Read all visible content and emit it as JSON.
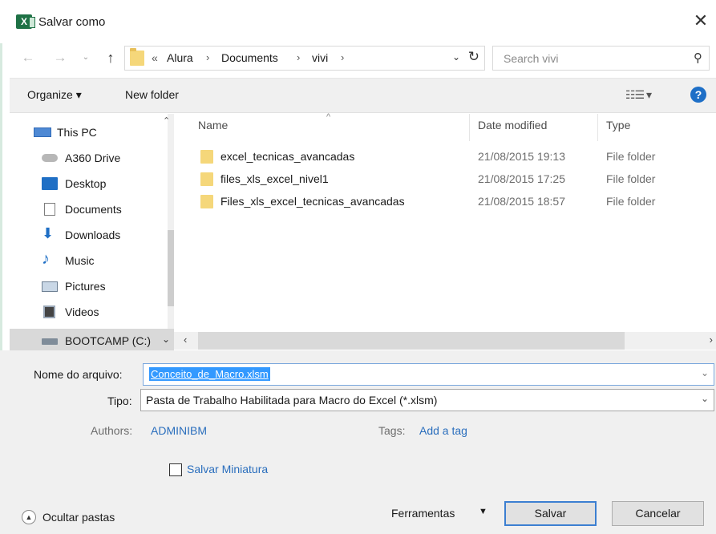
{
  "window": {
    "title": "Salvar como",
    "app_icon_letter": "X",
    "close_glyph": "✕",
    "accent_color": "#1e7145"
  },
  "navigation": {
    "back_glyph": "←",
    "forward_glyph": "→",
    "recent_glyph": "⌄",
    "up_glyph": "↑",
    "breadcrumb": [
      "«",
      "Alura",
      "Documents",
      "vivi"
    ],
    "separator_glyph": "›",
    "dropdown_glyph": "⌄",
    "refresh_glyph": "↻"
  },
  "search": {
    "placeholder": "Search vivi",
    "icon": "search-icon",
    "glyph": "⚲"
  },
  "toolbar": {
    "organize_label": "Organize ▾",
    "new_folder_label": "New folder",
    "view_label": "☷☰ ▾",
    "help_label": "?"
  },
  "sidebar": {
    "scroll_up_glyph": "⌃",
    "items": [
      {
        "label": "This PC",
        "icon": "computer-icon"
      },
      {
        "label": "A360 Drive",
        "icon": "cloud-icon"
      },
      {
        "label": "Desktop",
        "icon": "desktop-icon"
      },
      {
        "label": "Documents",
        "icon": "documents-icon"
      },
      {
        "label": "Downloads",
        "icon": "download-arrow-icon",
        "glyph": "⬇"
      },
      {
        "label": "Music",
        "icon": "music-note-icon",
        "glyph": "♪"
      },
      {
        "label": "Pictures",
        "icon": "pictures-icon"
      },
      {
        "label": "Videos",
        "icon": "film-icon"
      },
      {
        "label": "BOOTCAMP (C:)",
        "icon": "drive-icon",
        "expand_glyph": "⌄"
      }
    ]
  },
  "file_list": {
    "columns": {
      "name": "Name",
      "date": "Date modified",
      "type": "Type"
    },
    "sort_glyph": "^",
    "rows": [
      {
        "name": "excel_tecnicas_avancadas",
        "date": "21/08/2015 19:13",
        "type": "File folder"
      },
      {
        "name": "files_xls_excel_nivel1",
        "date": "21/08/2015 17:25",
        "type": "File folder"
      },
      {
        "name": "Files_xls_excel_tecnicas_avancadas",
        "date": "21/08/2015 18:57",
        "type": "File folder"
      }
    ],
    "scroll_left_glyph": "‹",
    "scroll_right_glyph": "›"
  },
  "save_form": {
    "filename_label": "Nome do arquivo:",
    "filename_value": "Conceito_de_Macro.xlsm",
    "type_label": "Tipo:",
    "type_value": "Pasta de Trabalho Habilitada para Macro do Excel (*.xlsm)",
    "dropdown_glyph": "⌄",
    "authors_label": "Authors:",
    "authors_value": "ADMINIBM",
    "tags_label": "Tags:",
    "tags_value": "Add a tag",
    "thumbnail_label": "Salvar Miniatura",
    "thumbnail_checked": false,
    "hide_folders_label": "Ocultar pastas",
    "hide_folders_glyph": "▲",
    "tools_label": "Ferramentas",
    "tools_dd_glyph": "▼",
    "save_label": "Salvar",
    "cancel_label": "Cancelar"
  }
}
